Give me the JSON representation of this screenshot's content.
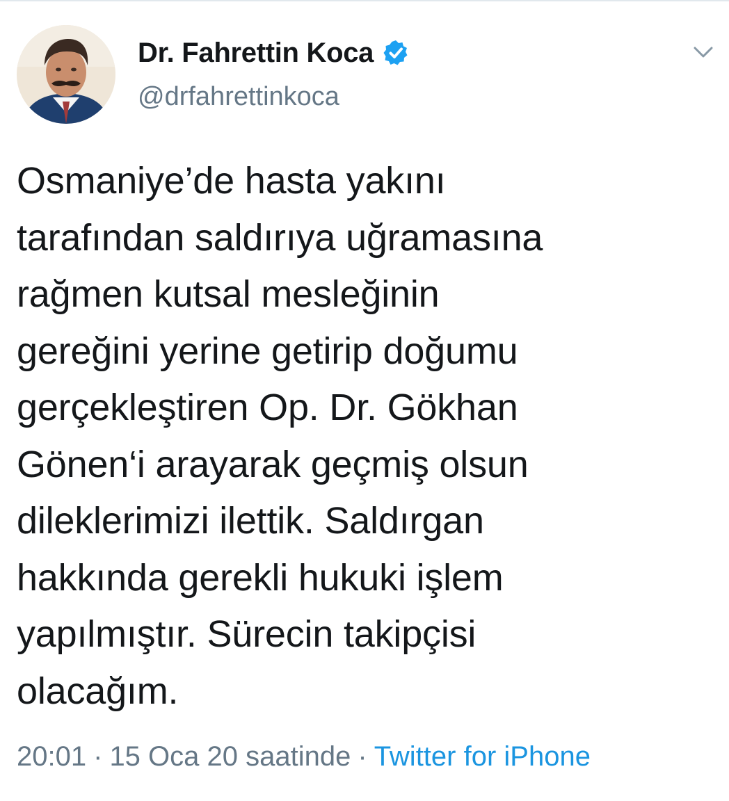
{
  "tweet": {
    "author": {
      "display_name": "Dr. Fahrettin Koca",
      "handle": "@drfahrettinkoca",
      "verified": true,
      "avatar_icon": "profile-photo"
    },
    "menu_icon": "chevron-down-icon",
    "text_lines": [
      "Osmaniye’de hasta yakını",
      "tarafından saldırıya uğramasına",
      "rağmen kutsal mesleğinin",
      "gereğini yerine getirip doğumu",
      "gerçekleştiren Op. Dr. Gökhan",
      "Gönen‘i arayarak geçmiş olsun",
      "dileklerimizi ilettik. Saldırgan",
      "hakkında gerekli hukuki işlem",
      "yapılmıştır. Sürecin takipçisi",
      "olacağım."
    ],
    "time": "20:01",
    "date": "15 Oca 20 saatinde",
    "separator": "·",
    "source": "Twitter for iPhone"
  },
  "colors": {
    "text": "#14171a",
    "secondary": "#657786",
    "link": "#1b95e0",
    "verified_badge": "#1da1f2"
  }
}
